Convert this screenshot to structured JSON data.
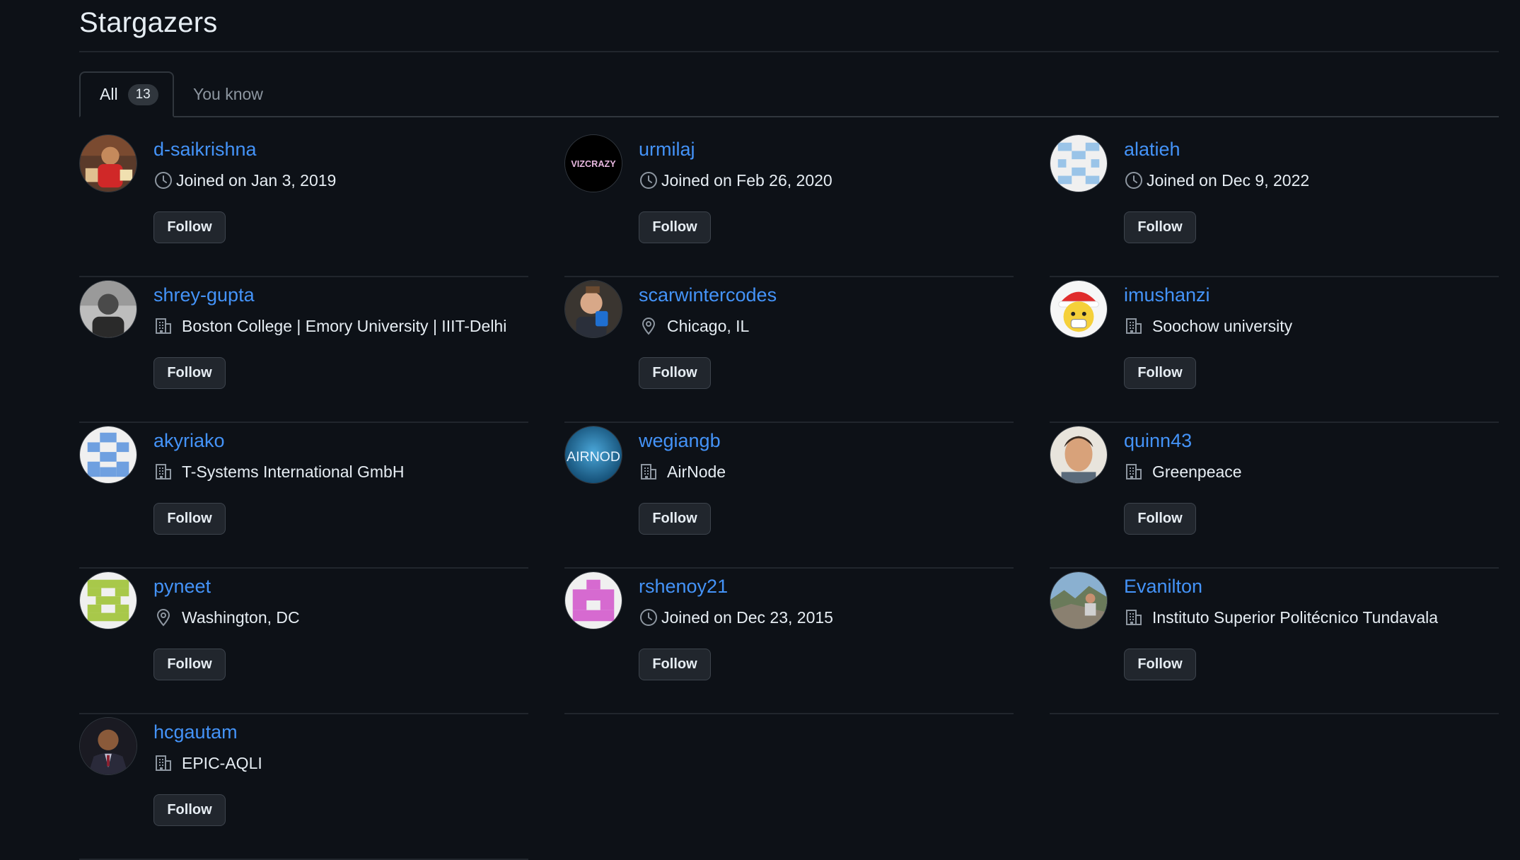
{
  "page": {
    "title": "Stargazers"
  },
  "tabs": {
    "all_label": "All",
    "all_count": "13",
    "you_know_label": "You know"
  },
  "follow_label": "Follow",
  "colors": {
    "background": "#0d1117",
    "link": "#4493f8",
    "button_bg": "#21262d",
    "border": "#30363d"
  },
  "users": [
    {
      "username": "d-saikrishna",
      "meta_type": "clock-icon",
      "meta": "Joined on Jan 3, 2019"
    },
    {
      "username": "urmilaj",
      "meta_type": "clock-icon",
      "meta": "Joined on Feb 26, 2020",
      "avatar_text": "VIZCRAZY"
    },
    {
      "username": "alatieh",
      "meta_type": "clock-icon",
      "meta": "Joined on Dec 9, 2022"
    },
    {
      "username": "shrey-gupta",
      "meta_type": "organization-icon",
      "meta": "Boston College | Emory University | IIIT-Delhi"
    },
    {
      "username": "scarwintercodes",
      "meta_type": "location-icon",
      "meta": "Chicago, IL"
    },
    {
      "username": "imushanzi",
      "meta_type": "organization-icon",
      "meta": "Soochow university"
    },
    {
      "username": "akyriako",
      "meta_type": "organization-icon",
      "meta": "T-Systems International GmbH"
    },
    {
      "username": "wegiangb",
      "meta_type": "organization-icon",
      "meta": "AirNode",
      "avatar_text": "AIRNOD"
    },
    {
      "username": "quinn43",
      "meta_type": "organization-icon",
      "meta": "Greenpeace"
    },
    {
      "username": "pyneet",
      "meta_type": "location-icon",
      "meta": "Washington, DC"
    },
    {
      "username": "rshenoy21",
      "meta_type": "clock-icon",
      "meta": "Joined on Dec 23, 2015"
    },
    {
      "username": "Evanilton",
      "meta_type": "organization-icon",
      "meta": "Instituto Superior Politécnico Tundavala"
    },
    {
      "username": "hcgautam",
      "meta_type": "organization-icon",
      "meta": "EPIC-AQLI"
    }
  ]
}
